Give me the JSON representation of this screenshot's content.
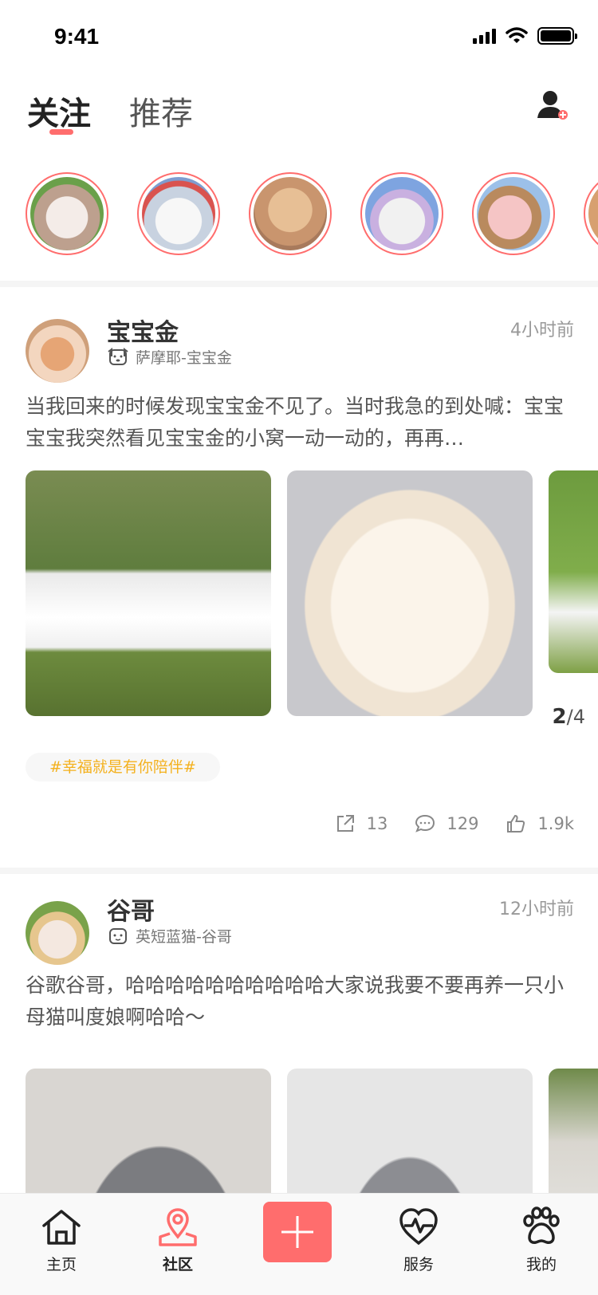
{
  "status_bar": {
    "time": "9:41"
  },
  "header": {
    "tabs": [
      {
        "label": "关注",
        "active": true
      },
      {
        "label": "推荐",
        "active": false
      }
    ],
    "add_user_icon": "add-user-icon"
  },
  "stories": [
    {
      "name": "cat-story-1",
      "colors": [
        "#c9a",
        "#e8d0c0"
      ]
    },
    {
      "name": "cat-story-2",
      "colors": [
        "#b3c3d8",
        "#f3f3f3"
      ]
    },
    {
      "name": "cat-story-3",
      "colors": [
        "#d9b08c",
        "#e9cfb4"
      ]
    },
    {
      "name": "cat-story-4",
      "colors": [
        "#86a8e0",
        "#f1f1f1"
      ]
    },
    {
      "name": "pig-story",
      "colors": [
        "#8cb0e0",
        "#f2c8c8"
      ]
    }
  ],
  "posts": [
    {
      "username": "宝宝金",
      "breed": "萨摩耶-宝宝金",
      "time": "4小时前",
      "text": "当我回来的时候发现宝宝金不见了。当时我急的到处喊：宝宝宝宝我突然看见宝宝金的小窝一动一动的，再再…",
      "page_current": "2",
      "page_total": "/4",
      "hashtag": "#幸福就是有你陪伴#",
      "shares": "13",
      "comments": "129",
      "likes": "1.9k"
    },
    {
      "username": "谷哥",
      "breed": "英短蓝猫-谷哥",
      "time": "12小时前",
      "text": "谷歌谷哥，哈哈哈哈哈哈哈哈哈哈大家说我要不要再养一只小母猫叫度娘啊哈哈～"
    }
  ],
  "tabbar": {
    "items": [
      {
        "label": "主页",
        "icon": "home-icon"
      },
      {
        "label": "社区",
        "icon": "community-icon"
      },
      {
        "label": "",
        "icon": "plus-icon"
      },
      {
        "label": "服务",
        "icon": "health-icon"
      },
      {
        "label": "我的",
        "icon": "paw-icon"
      }
    ]
  },
  "colors": {
    "accent": "#ff6d6d",
    "hashtag": "#f4b11d",
    "muted": "#999999"
  }
}
